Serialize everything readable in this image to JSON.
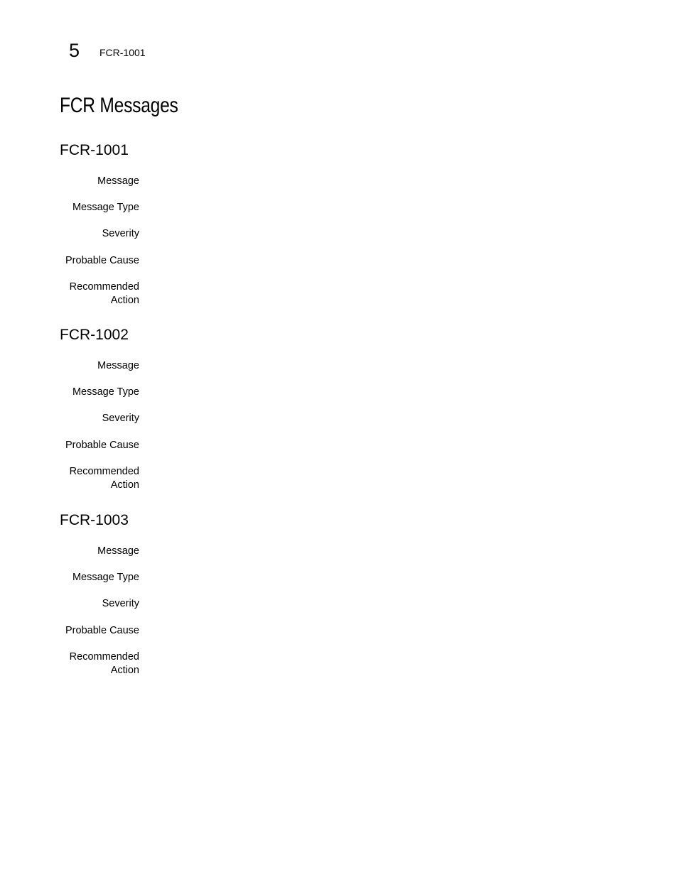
{
  "header": {
    "chapter_number": "5",
    "running_title": "FCR-1001"
  },
  "page_title": "FCR Messages",
  "sections": [
    {
      "id": "FCR-1001",
      "fields": [
        {
          "label": "Message",
          "value": ""
        },
        {
          "label": "Message Type",
          "value": ""
        },
        {
          "label": "Severity",
          "value": ""
        },
        {
          "label": "Probable Cause",
          "value": ""
        },
        {
          "label": "Recommended Action",
          "value": ""
        }
      ]
    },
    {
      "id": "FCR-1002",
      "fields": [
        {
          "label": "Message",
          "value": ""
        },
        {
          "label": "Message Type",
          "value": ""
        },
        {
          "label": "Severity",
          "value": ""
        },
        {
          "label": "Probable Cause",
          "value": ""
        },
        {
          "label": "Recommended Action",
          "value": ""
        }
      ]
    },
    {
      "id": "FCR-1003",
      "fields": [
        {
          "label": "Message",
          "value": ""
        },
        {
          "label": "Message Type",
          "value": ""
        },
        {
          "label": "Severity",
          "value": ""
        },
        {
          "label": "Probable Cause",
          "value": ""
        },
        {
          "label": "Recommended Action",
          "value": ""
        }
      ]
    }
  ]
}
